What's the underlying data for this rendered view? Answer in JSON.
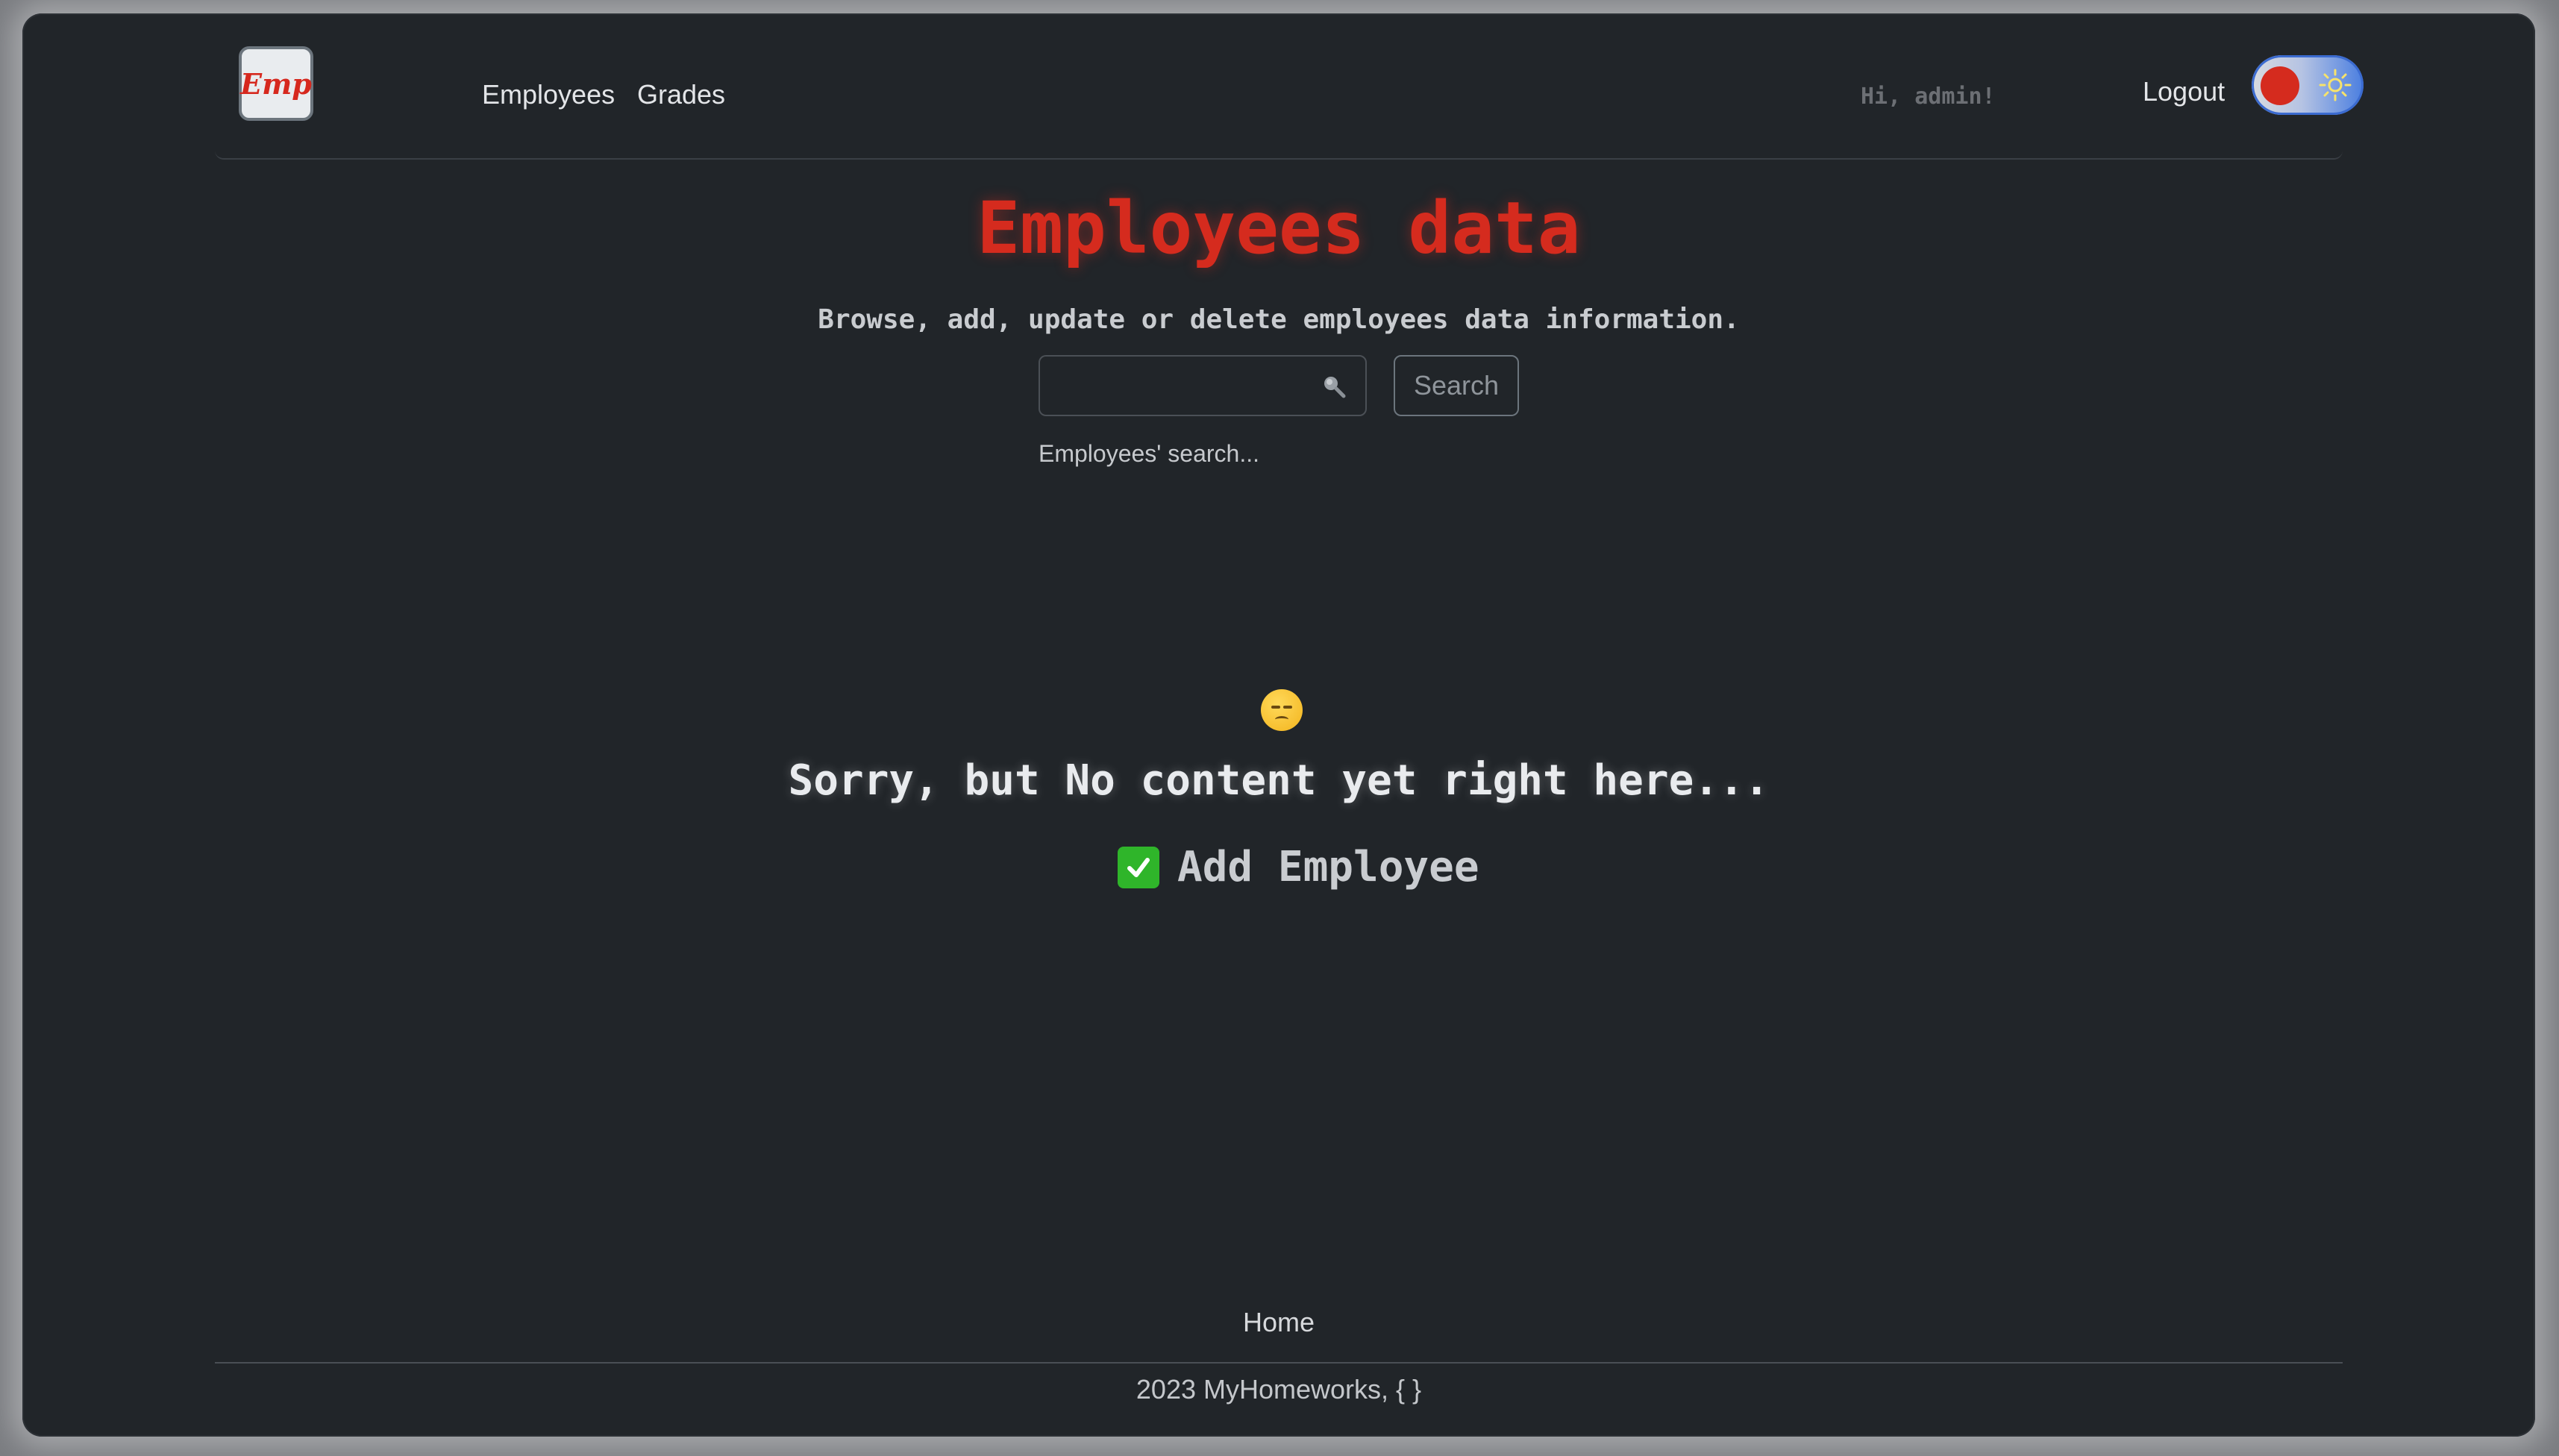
{
  "navbar": {
    "logo_text": "Emp",
    "links": [
      "Employees",
      "Grades"
    ],
    "greeting": "Hi, admin!",
    "logout_label": "Logout",
    "theme_icon": "sun-icon"
  },
  "header": {
    "title": "Employees data",
    "subtitle": "Browse, add, update or delete employees data information."
  },
  "search": {
    "value": "",
    "placeholder": "",
    "button_label": "Search",
    "help_text": "Employees' search..."
  },
  "empty_state": {
    "emoji": "pensive-face",
    "message": "Sorry, but No content yet right here...",
    "add_label": "Add Employee"
  },
  "footer": {
    "home_label": "Home",
    "copyright": "2023 MyHomeworks, { }"
  },
  "colors": {
    "background": "#212529",
    "accent": "#d52b1e",
    "toggle_blue": "#4a7ee0"
  }
}
